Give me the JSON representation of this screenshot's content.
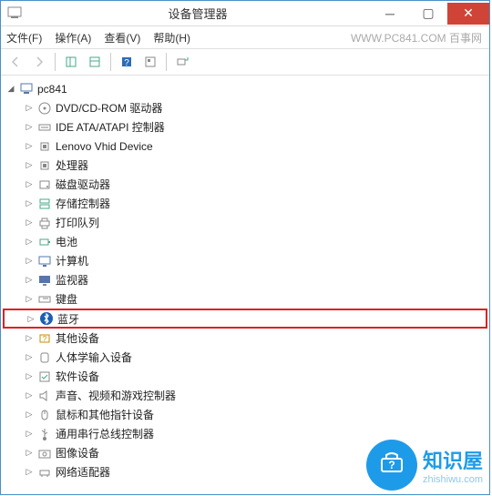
{
  "window": {
    "title": "设备管理器"
  },
  "menu": {
    "file": "文件(F)",
    "action": "操作(A)",
    "view": "查看(V)",
    "help": "帮助(H)"
  },
  "watermark": "WWW.PC841.COM 百事网",
  "tree": {
    "root": "pc841",
    "items": [
      {
        "label": "DVD/CD-ROM 驱动器",
        "icon": "disc"
      },
      {
        "label": "IDE ATA/ATAPI 控制器",
        "icon": "ide"
      },
      {
        "label": "Lenovo Vhid Device",
        "icon": "chip"
      },
      {
        "label": "处理器",
        "icon": "cpu"
      },
      {
        "label": "磁盘驱动器",
        "icon": "disk"
      },
      {
        "label": "存储控制器",
        "icon": "storage"
      },
      {
        "label": "打印队列",
        "icon": "printer"
      },
      {
        "label": "电池",
        "icon": "battery"
      },
      {
        "label": "计算机",
        "icon": "computer"
      },
      {
        "label": "监视器",
        "icon": "monitor"
      },
      {
        "label": "键盘",
        "icon": "keyboard"
      },
      {
        "label": "蓝牙",
        "icon": "bluetooth",
        "highlighted": true
      },
      {
        "label": "其他设备",
        "icon": "other"
      },
      {
        "label": "人体学输入设备",
        "icon": "hid"
      },
      {
        "label": "软件设备",
        "icon": "software"
      },
      {
        "label": "声音、视频和游戏控制器",
        "icon": "audio"
      },
      {
        "label": "鼠标和其他指针设备",
        "icon": "mouse"
      },
      {
        "label": "通用串行总线控制器",
        "icon": "usb"
      },
      {
        "label": "图像设备",
        "icon": "camera"
      },
      {
        "label": "网络适配器",
        "icon": "network"
      }
    ]
  },
  "logo": {
    "main": "知识屋",
    "sub": "zhishiwu.com"
  }
}
